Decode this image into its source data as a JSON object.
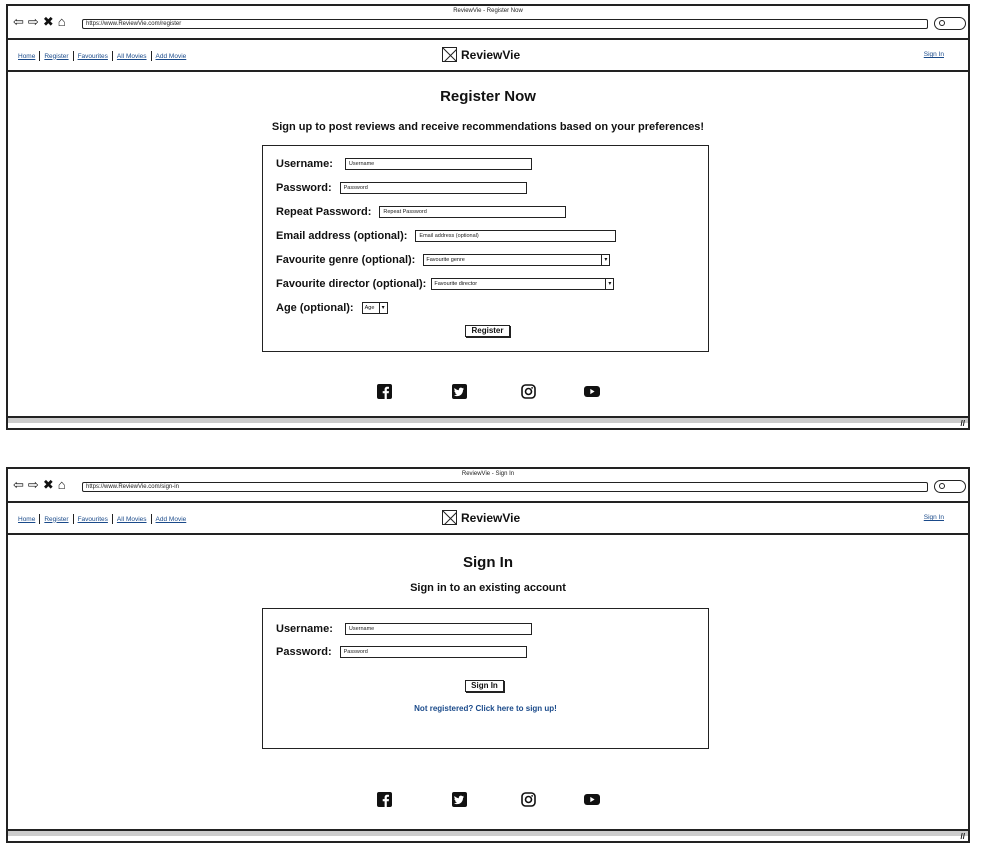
{
  "nav": {
    "home": "Home",
    "register": "Register",
    "favourites": "Favourites",
    "all_movies": "All Movies",
    "add_movie": "Add Movie",
    "sign_in": "Sign In",
    "brand": "ReviewVie"
  },
  "register_window": {
    "title": "ReviewVie - Register Now",
    "url": "https://www.ReviewVie.com/register",
    "heading": "Register Now",
    "subheading": "Sign up to post reviews and receive recommendations based on your preferences!",
    "fields": {
      "username": {
        "label": "Username:",
        "placeholder": "Username"
      },
      "password": {
        "label": "Password:",
        "placeholder": "Password"
      },
      "repeat_password": {
        "label": "Repeat Password:",
        "placeholder": "Repeat Password"
      },
      "email": {
        "label": "Email address (optional):",
        "placeholder": "Email address (optional)"
      },
      "genre": {
        "label": "Favourite genre (optional):",
        "value": "Favourite genre"
      },
      "director": {
        "label": "Favourite director (optional):",
        "value": "Favourite director"
      },
      "age": {
        "label": "Age (optional):",
        "value": "Age"
      }
    },
    "submit": "Register"
  },
  "signin_window": {
    "title": "ReviewVie - Sign In",
    "url": "https://www.ReviewVie.com/sign-in",
    "heading": "Sign In",
    "subheading": "Sign in to an existing account",
    "fields": {
      "username": {
        "label": "Username:",
        "placeholder": "Username"
      },
      "password": {
        "label": "Password:",
        "placeholder": "Password"
      }
    },
    "submit": "Sign In",
    "signup_link": "Not registered? Click here to sign up!"
  },
  "social_icons": [
    "facebook-icon",
    "twitter-icon",
    "instagram-icon",
    "youtube-icon"
  ]
}
